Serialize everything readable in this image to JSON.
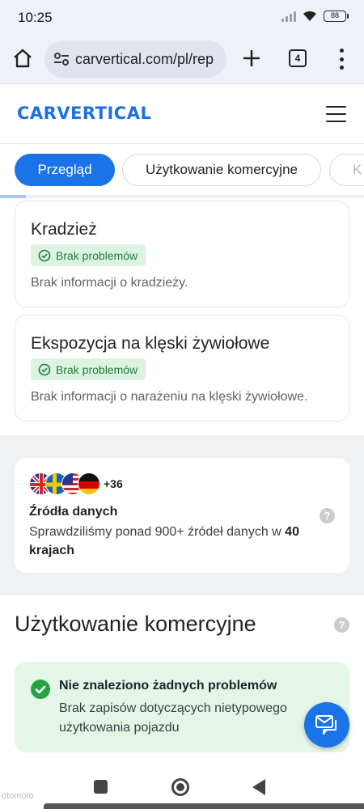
{
  "status_bar": {
    "time": "10:25",
    "battery": "88"
  },
  "browser": {
    "url": "carvertical.com/pl/rep",
    "tab_count": "4"
  },
  "site": {
    "logo": "CARVERTICAL"
  },
  "tabs": [
    {
      "label": "Przegląd",
      "active": true
    },
    {
      "label": "Użytkowanie komercyjne",
      "active": false
    },
    {
      "label": "K",
      "active": false
    }
  ],
  "scroll_progress_percent": 7,
  "cards": [
    {
      "title": "Kradzież",
      "badge": "Brak problemów",
      "description": "Brak informacji o kradzieży."
    },
    {
      "title": "Ekspozycja na klęski żywiołowe",
      "badge": "Brak problemów",
      "description": "Brak informacji o narażeniu na klęski żywiołowe."
    }
  ],
  "sources": {
    "extra_count": "+36",
    "title": "Źródła danych",
    "text_prefix": "Sprawdziliśmy ponad 900+ źródeł danych w ",
    "text_bold": "40 krajach",
    "flags": [
      "uk-flag",
      "sweden-flag",
      "usa-flag",
      "germany-flag"
    ]
  },
  "commercial": {
    "heading": "Użytkowanie komercyjne",
    "status_title": "Nie znaleziono żadnych problemów",
    "status_text": "Brak zapisów dotyczących nietypowego użytkowania pojazdu"
  },
  "watermark": "otomoto",
  "colors": {
    "brand": "#1a73e8",
    "success_bg": "#e3f6e7",
    "badge_bg": "#ddf3e2",
    "success": "#27a344"
  }
}
